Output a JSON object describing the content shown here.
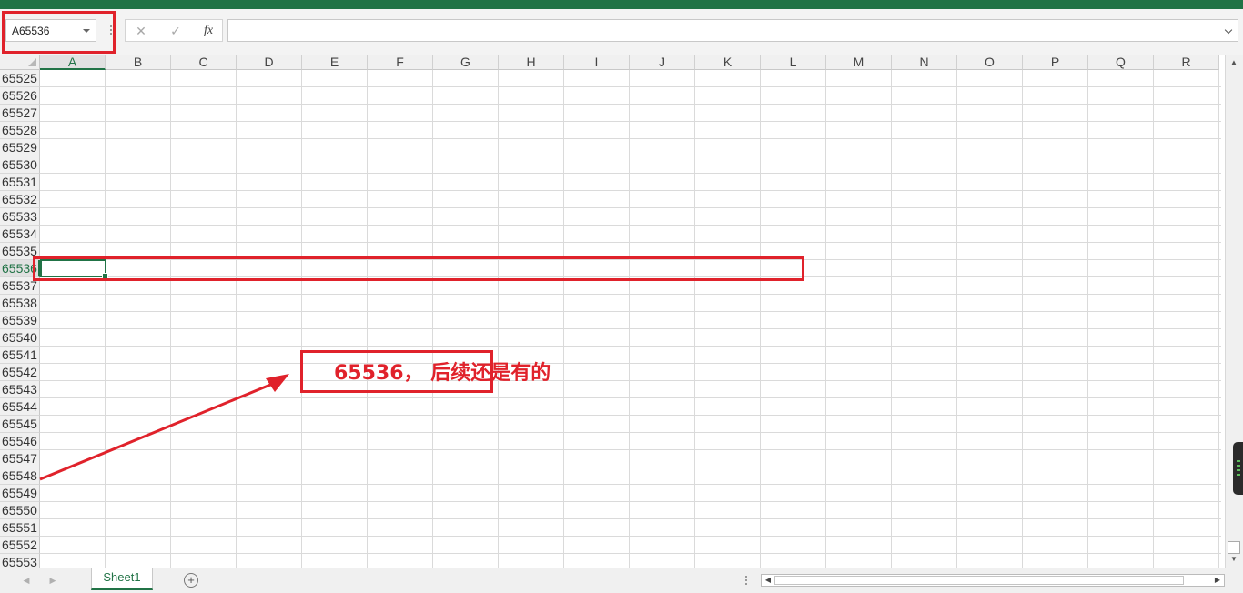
{
  "formula_bar": {
    "name_box": "A65536",
    "cancel_symbol": "✕",
    "enter_symbol": "✓",
    "fx_label": "fx",
    "formula_value": ""
  },
  "columns": [
    "A",
    "B",
    "C",
    "D",
    "E",
    "F",
    "G",
    "H",
    "I",
    "J",
    "K",
    "L",
    "M",
    "N",
    "O",
    "P",
    "Q",
    "R"
  ],
  "selected_column": "A",
  "rows": [
    "65525",
    "65526",
    "65527",
    "65528",
    "65529",
    "65530",
    "65531",
    "65532",
    "65533",
    "65534",
    "65535",
    "65536",
    "65537",
    "65538",
    "65539",
    "65540",
    "65541",
    "65542",
    "65543",
    "65544",
    "65545",
    "65546",
    "65547",
    "65548",
    "65549",
    "65550",
    "65551",
    "65552",
    "65553"
  ],
  "selected_row": "65536",
  "sheet_tabs": {
    "active": "Sheet1",
    "add_symbol": "+"
  },
  "annotation": {
    "text": "65536， 后续还是有的",
    "color": "#e0222b"
  },
  "colors": {
    "accent": "#217346",
    "annotation": "#e0222b"
  },
  "icons": [
    "cancel-icon",
    "enter-icon",
    "function-icon",
    "chevron-down-icon",
    "add-sheet-icon",
    "scroll-up-icon",
    "scroll-down-icon",
    "scroll-left-icon",
    "scroll-right-icon"
  ]
}
